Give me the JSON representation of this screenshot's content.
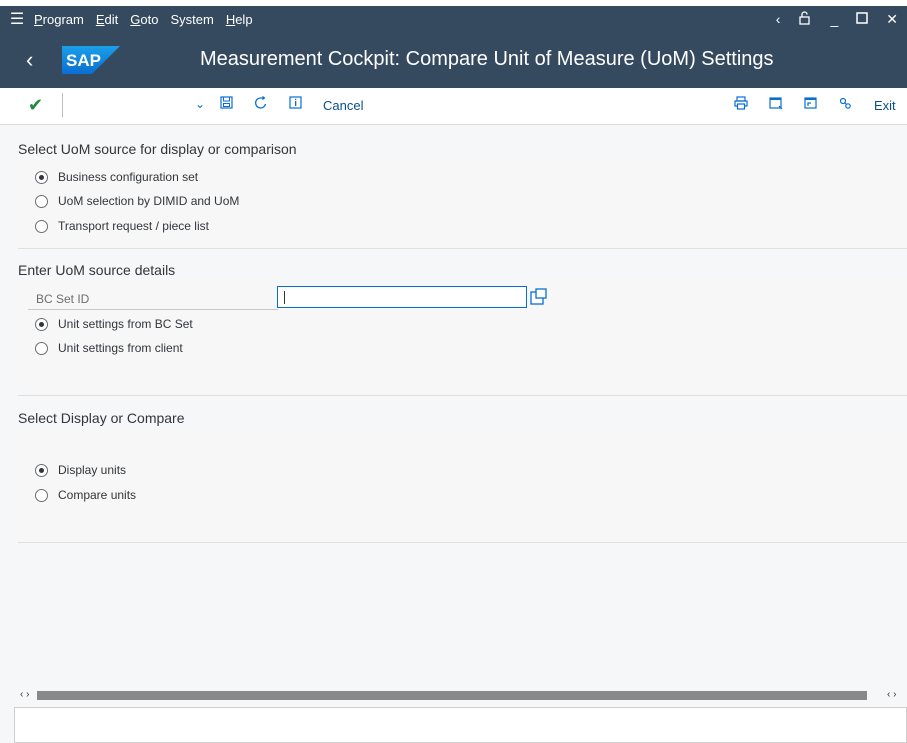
{
  "menubar": {
    "items": [
      {
        "label": "Program",
        "underline": "P",
        "rest": "rogram"
      },
      {
        "label": "Edit",
        "underline": "E",
        "rest": "dit"
      },
      {
        "label": "Goto",
        "underline": "G",
        "rest": "oto"
      },
      {
        "label": "System",
        "underline": "",
        "rest": "System"
      },
      {
        "label": "Help",
        "underline": "H",
        "rest": "elp"
      }
    ]
  },
  "titlebar": {
    "logo_text": "SAP",
    "title": "Measurement Cockpit: Compare Unit of Measure (UoM) Settings"
  },
  "toolbar": {
    "cancel_label": "Cancel",
    "exit_label": "Exit",
    "command_value": ""
  },
  "section1": {
    "title": "Select UoM source for display or comparison",
    "options": [
      {
        "label": "Business configuration set",
        "selected": true
      },
      {
        "label": "UoM selection by DIMID and UoM",
        "selected": false
      },
      {
        "label": "Transport request / piece list",
        "selected": false
      }
    ]
  },
  "section2": {
    "title": "Enter UoM source details",
    "field_label": "BC Set ID",
    "field_value": "",
    "options": [
      {
        "label": "Unit settings from BC Set",
        "selected": true
      },
      {
        "label": "Unit settings from client",
        "selected": false
      }
    ]
  },
  "section3": {
    "title": "Select Display or Compare",
    "options": [
      {
        "label": "Display units",
        "selected": true
      },
      {
        "label": "Compare units",
        "selected": false
      }
    ]
  },
  "colors": {
    "shell": "#354a5f",
    "accent": "#0a6ed1",
    "check": "#1e8a3a"
  }
}
